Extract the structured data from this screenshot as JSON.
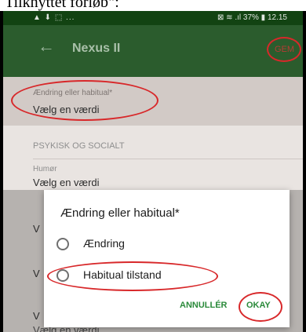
{
  "caption": "Tilknyttet forløb\":",
  "status_bar": {
    "left_icons": "▲ ⬇ ⬚ ...",
    "right": "⊠ ≋ .ıl 37% ▮ 12.15"
  },
  "app_bar": {
    "title": "Nexus II",
    "save_label": "GEM"
  },
  "form": {
    "field1": {
      "label": "Ændring eller habitual*",
      "value": "Vælg en værdi"
    },
    "section": "PSYKISK OG SOCIALT",
    "field2": {
      "label": "Humør",
      "value": "Vælg en værdi"
    },
    "partial_row1": "V",
    "partial_row2": "V",
    "partial_row3": "V",
    "last_value": "Vælg en værdi"
  },
  "dialog": {
    "title": "Ændring eller habitual*",
    "options": [
      {
        "label": "Ændring",
        "selected": false
      },
      {
        "label": "Habitual tilstand",
        "selected": false
      }
    ],
    "cancel_label": "ANNULLÉR",
    "ok_label": "OKAY"
  },
  "colors": {
    "app_bar": "#2b5c2d",
    "status_bar": "#124312",
    "accent": "#2a8a3a",
    "highlight_oval": "#d8282a"
  },
  "icons": {
    "back": "arrow-left-icon",
    "radio": "radio-unchecked-icon"
  }
}
